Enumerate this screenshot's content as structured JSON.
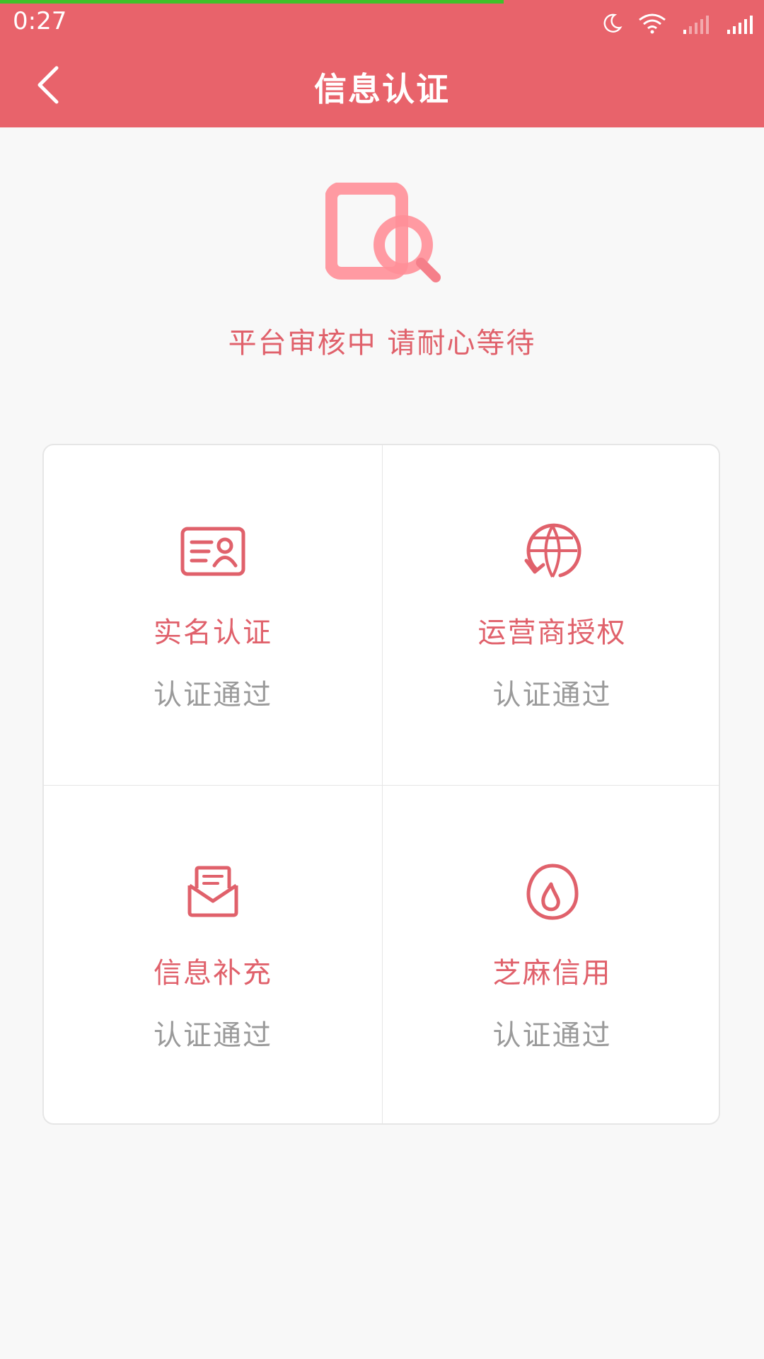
{
  "status_bar": {
    "time": "0:27",
    "icons": [
      "moon-icon",
      "wifi-icon",
      "signal-weak-icon",
      "signal-full-icon"
    ]
  },
  "header": {
    "title": "信息认证",
    "back_icon": "back-arrow-icon",
    "background_color": "#e8636b"
  },
  "review": {
    "icon": "document-search-icon",
    "message": "平台审核中 请耐心等待"
  },
  "items": [
    {
      "icon": "id-card-icon",
      "title": "实名认证",
      "status": "认证通过"
    },
    {
      "icon": "globe-icon",
      "title": "运营商授权",
      "status": "认证通过"
    },
    {
      "icon": "envelope-icon",
      "title": "信息补充",
      "status": "认证通过"
    },
    {
      "icon": "sesame-drop-icon",
      "title": "芝麻信用",
      "status": "认证通过"
    }
  ],
  "colors": {
    "accent": "#e0616b",
    "status_text": "#9a9a9a",
    "progress": "#3fc12a"
  }
}
